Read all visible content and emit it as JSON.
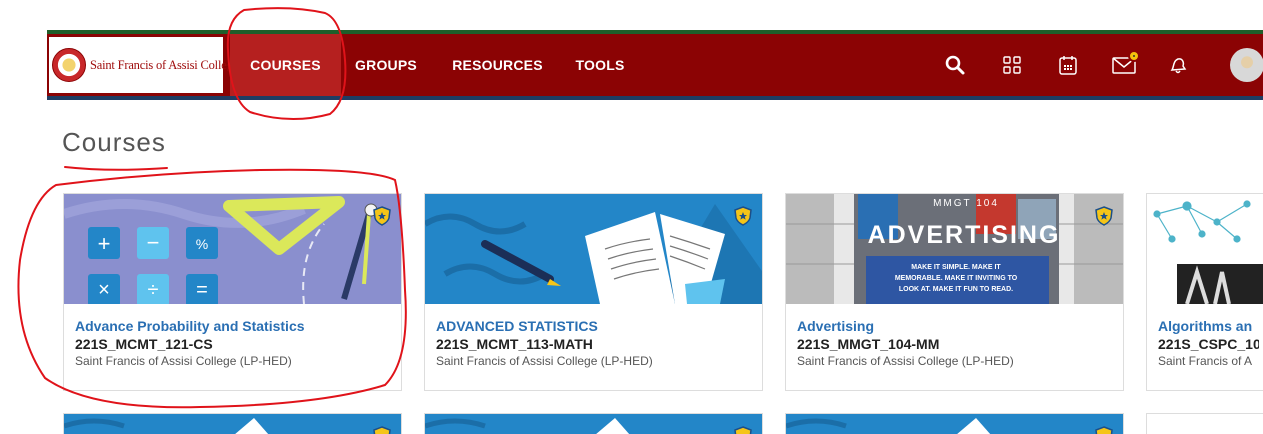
{
  "header": {
    "logo_text": "Saint Francis of Assisi College",
    "nav": [
      {
        "label": "COURSES",
        "active": true
      },
      {
        "label": "GROUPS",
        "active": false
      },
      {
        "label": "RESOURCES",
        "active": false
      },
      {
        "label": "TOOLS",
        "active": false
      }
    ],
    "icons": [
      "search-icon",
      "apps-grid-icon",
      "calendar-icon",
      "mail-icon",
      "bell-icon",
      "user-avatar"
    ],
    "colors": {
      "bar": "#8b0304",
      "active_tab": "#b5201f",
      "top_stripe": "#1f5e2a",
      "bottom_stripe": "#1f3d63",
      "notification_dot": "#f4c20d"
    }
  },
  "page": {
    "title": "Courses"
  },
  "courses": [
    {
      "title": "Advance Probability and Statistics",
      "code": "221S_MCMT_121-CS",
      "institution": "Saint Francis of Assisi College (LP-HED)",
      "image": "math-symbols"
    },
    {
      "title": "ADVANCED STATISTICS",
      "code": "221S_MCMT_113-MATH",
      "institution": "Saint Francis of Assisi College (LP-HED)",
      "image": "open-book"
    },
    {
      "title": "Advertising",
      "code": "221S_MMGT_104-MM",
      "institution": "Saint Francis of Assisi College (LP-HED)",
      "image": "advertising-billboard",
      "image_text": {
        "course": "MMGT 104",
        "headline": "ADVERTISING",
        "tagline_1": "MAKE IT SIMPLE. MAKE IT",
        "tagline_2": "MEMORABLE. MAKE IT INVITING TO",
        "tagline_3": "LOOK AT. MAKE IT FUN TO READ."
      }
    },
    {
      "title": "Algorithms an",
      "code": "221S_CSPC_10",
      "institution": "Saint Francis of A",
      "image": "network-graph"
    }
  ],
  "theme": {
    "link_color": "#2a6fb3",
    "card_image_blue": "#2386c8",
    "annotation_red": "#e0131a"
  }
}
